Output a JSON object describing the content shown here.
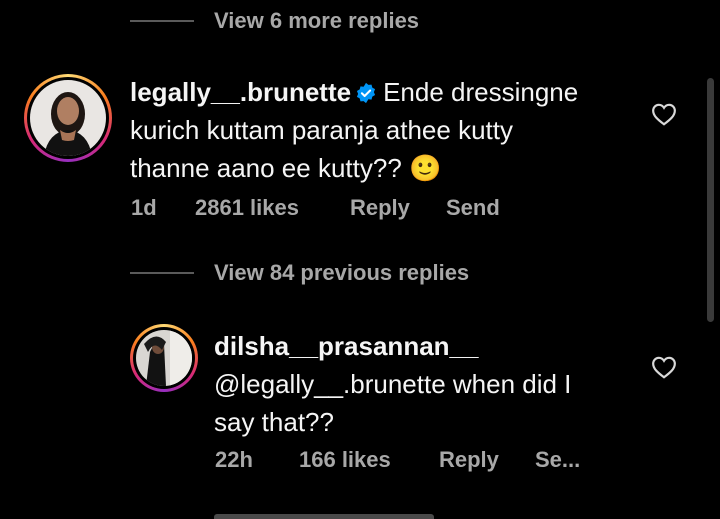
{
  "replies_top": {
    "label": "View 6 more replies"
  },
  "comment1": {
    "username": "legally__.brunette",
    "text_line1": "Ende dressingne",
    "text_line2": "kurich kuttam paranja athee kutty",
    "text_line3": "thanne aano ee kutty??",
    "emoji": "🙂",
    "time": "1d",
    "likes": "2861 likes",
    "reply": "Reply",
    "send": "Send",
    "verified_icon": "verified-badge-icon",
    "like_icon": "heart-outline-icon"
  },
  "replies_previous": {
    "label": "View 84 previous replies"
  },
  "comment2": {
    "username": "dilsha__prasannan__",
    "text_line1": "@legally__.brunette when did I",
    "text_line2": "say that??",
    "time": "22h",
    "likes": "166 likes",
    "reply": "Reply",
    "send": "Se...",
    "like_icon": "heart-outline-icon"
  },
  "colors": {
    "background": "#000000",
    "text": "#f5f5f5",
    "muted": "#a8a8a8",
    "verified": "#0095f6"
  }
}
